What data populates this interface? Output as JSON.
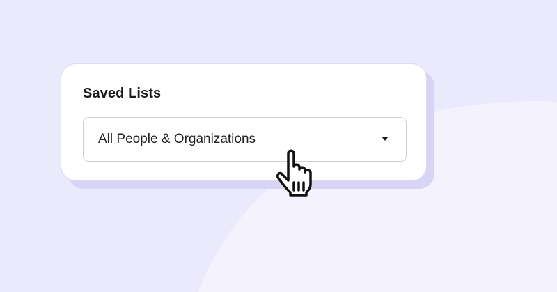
{
  "saved_lists": {
    "title": "Saved Lists",
    "select": {
      "value": "All People & Organizations",
      "caret_icon": "caret-down-icon"
    }
  },
  "cursor": {
    "icon": "hand-pointer-icon"
  },
  "colors": {
    "background": "#ebe9fc",
    "background_shape": "#f3f2fd",
    "card_shadow": "#d8d4f6",
    "card": "#ffffff",
    "select_border": "#cfcfcf",
    "text": "#1c1c1c"
  }
}
